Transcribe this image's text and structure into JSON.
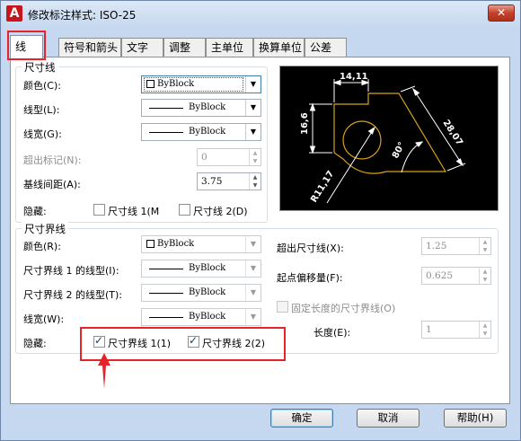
{
  "window": {
    "title": "修改标注样式: ISO-25",
    "app_icon": "A",
    "close_glyph": "✕"
  },
  "tabs": [
    {
      "label": "线"
    },
    {
      "label": "符号和箭头"
    },
    {
      "label": "文字"
    },
    {
      "label": "调整"
    },
    {
      "label": "主单位"
    },
    {
      "label": "换算单位"
    },
    {
      "label": "公差"
    }
  ],
  "dim_lines": {
    "title": "尺寸线",
    "color_label": "颜色(C):",
    "color_value": "ByBlock",
    "linetype_label": "线型(L):",
    "linetype_value": "ByBlock",
    "lineweight_label": "线宽(G):",
    "lineweight_value": "ByBlock",
    "extend_label": "超出标记(N):",
    "extend_value": "0",
    "baseline_label": "基线间距(A):",
    "baseline_value": "3.75",
    "suppress_label": "隐藏:",
    "suppress_1": "尺寸线 1(M",
    "suppress_2": "尺寸线 2(D)"
  },
  "ext_lines": {
    "title": "尺寸界线",
    "color_label": "颜色(R):",
    "color_value": "ByBlock",
    "linetype1_label": "尺寸界线 1 的线型(I):",
    "linetype1_value": "ByBlock",
    "linetype2_label": "尺寸界线 2 的线型(T):",
    "linetype2_value": "ByBlock",
    "lineweight_label": "线宽(W):",
    "lineweight_value": "ByBlock",
    "suppress_label": "隐藏:",
    "suppress_1": "尺寸界线 1(1)",
    "suppress_2": "尺寸界线 2(2)",
    "beyond_label": "超出尺寸线(X):",
    "beyond_value": "1.25",
    "offset_label": "起点偏移量(F):",
    "offset_value": "0.625",
    "fixed_label": "固定长度的尺寸界线(O)",
    "length_label": "长度(E):",
    "length_value": "1"
  },
  "preview": {
    "dim_top": "14,11",
    "dim_left": "16,6",
    "dim_right": "28,07",
    "dim_angle": "80°",
    "dim_radius": "R11,17"
  },
  "buttons": {
    "ok": "确定",
    "cancel": "取消",
    "help": "帮助(H)"
  },
  "colors": {
    "highlight": "#e4232b",
    "preview_bg": "#000000",
    "geometry": "#d9a21a"
  }
}
